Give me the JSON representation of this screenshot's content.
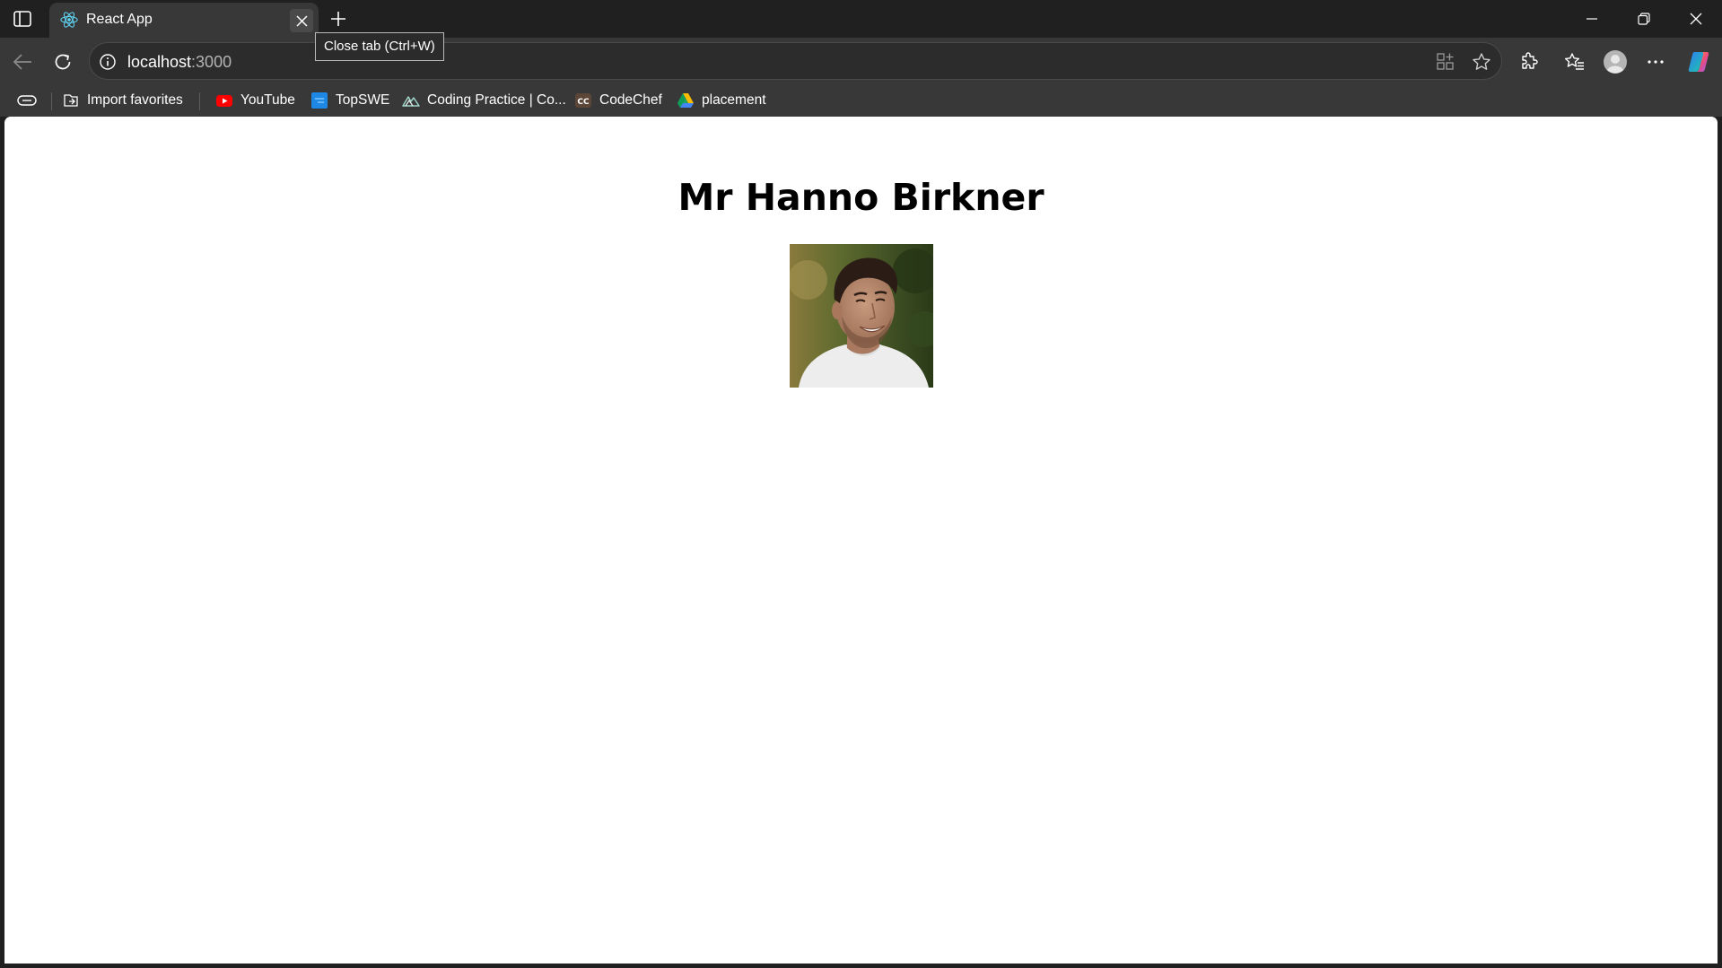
{
  "browser": {
    "tab": {
      "title": "React App"
    },
    "tooltip": "Close tab (Ctrl+W)",
    "address": {
      "host": "localhost",
      "port": ":3000"
    },
    "bookmarks": [
      {
        "label": "Import favorites",
        "icon": "import-favorites-icon"
      },
      {
        "label": "YouTube",
        "icon": "youtube-icon",
        "color": "#ff0000"
      },
      {
        "label": "TopSWE",
        "icon": "topswe-icon",
        "color": "#1e88e5"
      },
      {
        "label": "Coding Practice | Co...",
        "icon": "codestudio-icon",
        "color": "#9fd3c7"
      },
      {
        "label": "CodeChef",
        "icon": "codechef-icon",
        "color": "#5b4638"
      },
      {
        "label": "placement",
        "icon": "google-drive-icon"
      }
    ]
  },
  "page": {
    "heading": "Mr Hanno Birkner"
  }
}
